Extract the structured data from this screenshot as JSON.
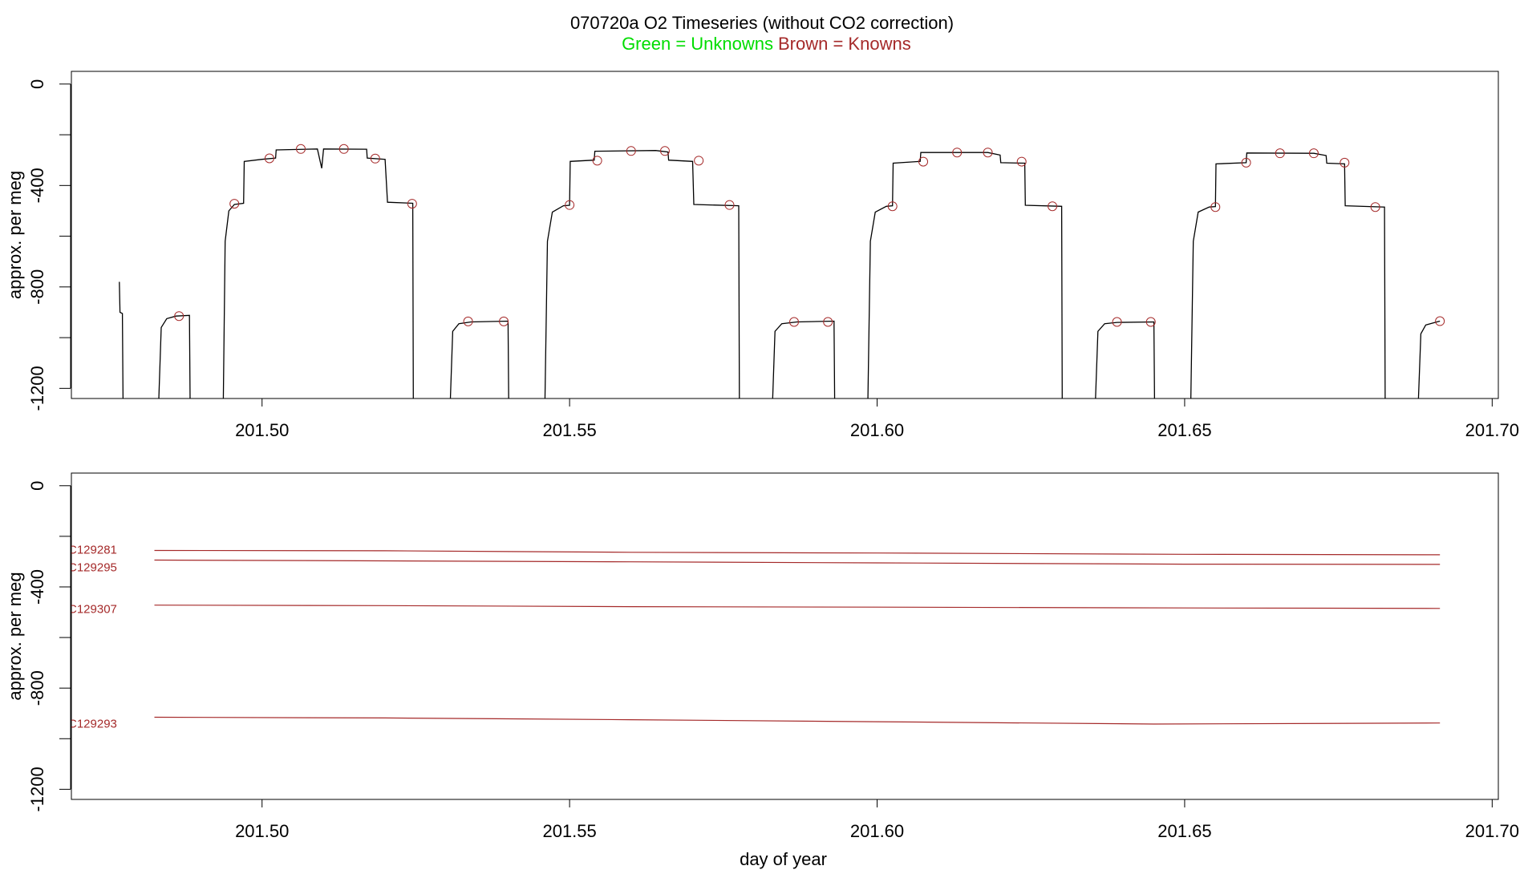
{
  "header": {
    "title": "070720a   O2 Timeseries (without CO2 correction)",
    "legend_unknowns": "Green = Unknowns",
    "legend_knowns": "Brown = Knowns",
    "colors": {
      "unknowns": "#00dd00",
      "knowns": "#a52a2a",
      "trace": "#000000"
    }
  },
  "chart_data": [
    {
      "type": "line",
      "xlim": [
        201.469,
        201.701
      ],
      "ylim": [
        -1240,
        50
      ],
      "ylabel": "approx. per meg",
      "xlabel": "",
      "x_ticks": [
        "201.50",
        "201.55",
        "201.60",
        "201.65",
        "201.70"
      ],
      "x_tick_values": [
        201.5,
        201.55,
        201.6,
        201.65,
        201.7
      ],
      "y_ticks": [
        "0",
        "-400",
        "-800",
        "-1200"
      ],
      "y_tick_values": [
        0,
        -200,
        -400,
        -600,
        -800,
        -1000,
        -1200
      ],
      "series": [
        {
          "role": "trace",
          "segments": [
            [
              [
                201.4768,
                -780
              ],
              [
                201.4769,
                -900
              ],
              [
                201.4773,
                -905
              ],
              [
                201.4774,
                -1250
              ]
            ],
            [
              [
                201.4832,
                -1250
              ],
              [
                201.4836,
                -960
              ],
              [
                201.4845,
                -925
              ],
              [
                201.486,
                -915
              ],
              [
                201.4882,
                -912
              ],
              [
                201.4883,
                -1250
              ]
            ],
            [
              [
                201.4937,
                -1250
              ],
              [
                201.494,
                -620
              ],
              [
                201.4946,
                -500
              ],
              [
                201.4955,
                -475
              ],
              [
                201.497,
                -470
              ],
              [
                201.4971,
                -305
              ],
              [
                201.5,
                -297
              ],
              [
                201.5022,
                -292
              ],
              [
                201.5023,
                -260
              ],
              [
                201.509,
                -256
              ],
              [
                201.5097,
                -332
              ],
              [
                201.51,
                -256
              ],
              [
                201.517,
                -257
              ],
              [
                201.5171,
                -292
              ],
              [
                201.52,
                -297
              ],
              [
                201.5204,
                -466
              ],
              [
                201.5245,
                -470
              ],
              [
                201.5246,
                -1250
              ]
            ],
            [
              [
                201.5306,
                -1250
              ],
              [
                201.531,
                -975
              ],
              [
                201.532,
                -945
              ],
              [
                201.534,
                -938
              ],
              [
                201.54,
                -935
              ],
              [
                201.5401,
                -1250
              ]
            ],
            [
              [
                201.546,
                -1250
              ],
              [
                201.5464,
                -620
              ],
              [
                201.5472,
                -505
              ],
              [
                201.549,
                -480
              ],
              [
                201.55,
                -478
              ],
              [
                201.5501,
                -305
              ],
              [
                201.554,
                -300
              ],
              [
                201.5541,
                -265
              ],
              [
                201.564,
                -262
              ],
              [
                201.566,
                -268
              ],
              [
                201.5661,
                -300
              ],
              [
                201.57,
                -305
              ],
              [
                201.5702,
                -475
              ],
              [
                201.5775,
                -480
              ],
              [
                201.5776,
                -1250
              ]
            ],
            [
              [
                201.583,
                -1250
              ],
              [
                201.5834,
                -975
              ],
              [
                201.5845,
                -945
              ],
              [
                201.587,
                -938
              ],
              [
                201.593,
                -935
              ],
              [
                201.5931,
                -1250
              ]
            ],
            [
              [
                201.5985,
                -1250
              ],
              [
                201.5989,
                -620
              ],
              [
                201.5997,
                -505
              ],
              [
                201.6015,
                -482
              ],
              [
                201.6025,
                -480
              ],
              [
                201.6026,
                -312
              ],
              [
                201.607,
                -305
              ],
              [
                201.6071,
                -270
              ],
              [
                201.618,
                -270
              ],
              [
                201.62,
                -280
              ],
              [
                201.6201,
                -310
              ],
              [
                201.624,
                -312
              ],
              [
                201.6241,
                -478
              ],
              [
                201.63,
                -482
              ],
              [
                201.6301,
                -1250
              ]
            ],
            [
              [
                201.6355,
                -1250
              ],
              [
                201.6359,
                -975
              ],
              [
                201.637,
                -945
              ],
              [
                201.639,
                -940
              ],
              [
                201.645,
                -938
              ],
              [
                201.6451,
                -1250
              ]
            ],
            [
              [
                201.651,
                -1250
              ],
              [
                201.6514,
                -620
              ],
              [
                201.6522,
                -505
              ],
              [
                201.654,
                -485
              ],
              [
                201.655,
                -483
              ],
              [
                201.6551,
                -315
              ],
              [
                201.66,
                -310
              ],
              [
                201.6601,
                -272
              ],
              [
                201.671,
                -273
              ],
              [
                201.673,
                -282
              ],
              [
                201.6731,
                -312
              ],
              [
                201.676,
                -315
              ],
              [
                201.6761,
                -480
              ],
              [
                201.6825,
                -485
              ],
              [
                201.6826,
                -1250
              ]
            ],
            [
              [
                201.688,
                -1250
              ],
              [
                201.6884,
                -985
              ],
              [
                201.6892,
                -950
              ],
              [
                201.691,
                -938
              ],
              [
                201.6915,
                -935
              ]
            ]
          ]
        },
        {
          "role": "known-markers",
          "points": [
            [
              201.4865,
              -915
            ],
            [
              201.4955,
              -472
            ],
            [
              201.5012,
              -293
            ],
            [
              201.5063,
              -256
            ],
            [
              201.5133,
              -256
            ],
            [
              201.5184,
              -294
            ],
            [
              201.5244,
              -472
            ],
            [
              201.5335,
              -936
            ],
            [
              201.5393,
              -936
            ],
            [
              201.55,
              -477
            ],
            [
              201.5545,
              -302
            ],
            [
              201.56,
              -264
            ],
            [
              201.5655,
              -264
            ],
            [
              201.571,
              -302
            ],
            [
              201.576,
              -477
            ],
            [
              201.5865,
              -938
            ],
            [
              201.592,
              -938
            ],
            [
              201.6025,
              -482
            ],
            [
              201.6075,
              -306
            ],
            [
              201.613,
              -270
            ],
            [
              201.618,
              -270
            ],
            [
              201.6235,
              -306
            ],
            [
              201.6285,
              -482
            ],
            [
              201.639,
              -938
            ],
            [
              201.6445,
              -938
            ],
            [
              201.655,
              -485
            ],
            [
              201.66,
              -310
            ],
            [
              201.6655,
              -273
            ],
            [
              201.671,
              -273
            ],
            [
              201.676,
              -310
            ],
            [
              201.681,
              -485
            ],
            [
              201.6915,
              -935
            ]
          ]
        }
      ]
    },
    {
      "type": "line",
      "xlim": [
        201.469,
        201.701
      ],
      "ylim": [
        -1240,
        50
      ],
      "ylabel": "approx. per meg",
      "xlabel": "day of year",
      "x_ticks": [
        "201.50",
        "201.55",
        "201.60",
        "201.65",
        "201.70"
      ],
      "x_tick_values": [
        201.5,
        201.55,
        201.6,
        201.65,
        201.7
      ],
      "y_ticks": [
        "0",
        "-400",
        "-800",
        "-1200"
      ],
      "y_tick_values": [
        0,
        -200,
        -400,
        -600,
        -800,
        -1000,
        -1200
      ],
      "series": [
        {
          "name": "C129281",
          "x": [
            201.4825,
            201.52,
            201.56,
            201.6,
            201.65,
            201.6915
          ],
          "values": [
            -256,
            -257,
            -263,
            -266,
            -271,
            -273
          ]
        },
        {
          "name": "C129295",
          "x": [
            201.4825,
            201.52,
            201.56,
            201.6,
            201.65,
            201.6915
          ],
          "values": [
            -294,
            -297,
            -301,
            -305,
            -310,
            -311
          ]
        },
        {
          "name": "C129307",
          "x": [
            201.4825,
            201.52,
            201.56,
            201.6,
            201.65,
            201.6915
          ],
          "values": [
            -472,
            -474,
            -478,
            -480,
            -483,
            -485
          ]
        },
        {
          "name": "C129293",
          "x": [
            201.4825,
            201.52,
            201.56,
            201.6,
            201.645,
            201.6915
          ],
          "values": [
            -915,
            -918,
            -925,
            -933,
            -942,
            -938
          ]
        }
      ]
    }
  ]
}
